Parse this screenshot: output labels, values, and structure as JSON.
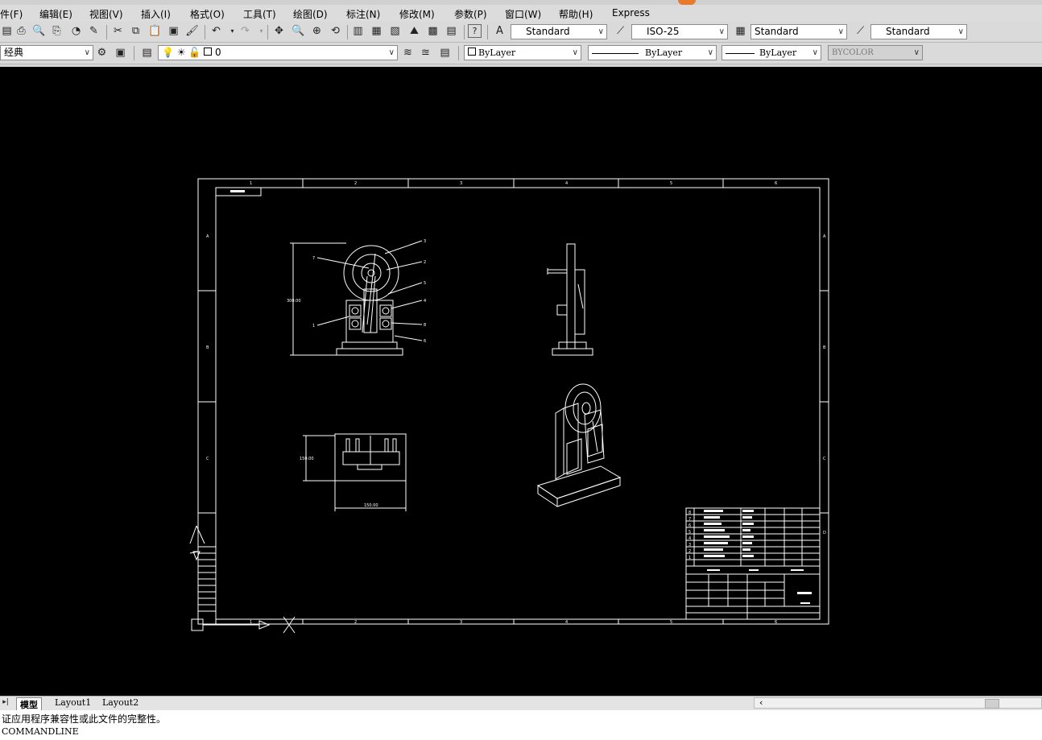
{
  "menu": [
    "件(F)",
    "编辑(E)",
    "视图(V)",
    "插入(I)",
    "格式(O)",
    "工具(T)",
    "绘图(D)",
    "标注(N)",
    "修改(M)",
    "参数(P)",
    "窗口(W)",
    "帮助(H)",
    "Express"
  ],
  "toolbar1": {
    "text_style": "Standard",
    "dim_style": "ISO-25",
    "table_style": "Standard",
    "multileader_style": "Standard"
  },
  "toolbar2": {
    "workspace": "经典",
    "layer": "0",
    "color": "ByLayer",
    "linetype": "ByLayer",
    "lineweight": "ByLayer",
    "plotstyle": "BYCOLOR"
  },
  "drawing": {
    "col_labels": [
      "1",
      "2",
      "3",
      "4",
      "5",
      "6"
    ],
    "row_labels": [
      "A",
      "B",
      "C",
      "D"
    ],
    "dim_height": "300.00",
    "dim_side": "150.00",
    "dim_width": "150.00",
    "balloons_right": [
      "3",
      "2",
      "5",
      "4",
      "8",
      "6"
    ],
    "balloons_left": [
      "7",
      "1"
    ],
    "bom_index": [
      "8",
      "7",
      "6",
      "5",
      "4",
      "3",
      "2",
      "1"
    ]
  },
  "tabs": {
    "model": "模型",
    "layout1": "Layout1",
    "layout2": "Layout2"
  },
  "command": {
    "line1": "证应用程序兼容性或此文件的完整性。",
    "line2": "COMMANDLINE"
  },
  "colors": {
    "canvas": "#000000",
    "lines": "#ffffff",
    "accent": "#e77a2c"
  }
}
